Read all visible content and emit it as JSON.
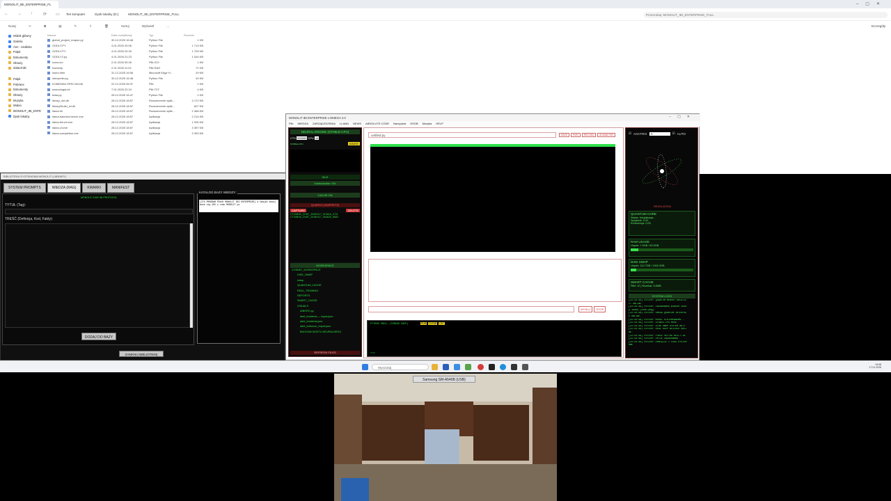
{
  "explorer": {
    "tab_title": "MONOLIT_IBI_ENTERPRISE_FL",
    "breadcrumbs": [
      "Ten komputer",
      "Dysk lokalny (D:)",
      "MONOLIT_IBI_ENTERPRISE_FULL"
    ],
    "search_placeholder": "Przeszukaj: MONOLIT_IBI_ENTERPRISE_FULL",
    "toolbar": [
      "Nowy",
      "Sortuj",
      "Wyświetl",
      "..."
    ],
    "details_label": "Szczegóły",
    "sidebar": [
      {
        "label": "Widok główny",
        "icon": "home-icon"
      },
      {
        "label": "Galeria",
        "icon": "gallery-icon"
      },
      {
        "label": "Ann - osobiste",
        "icon": "cloud-icon"
      },
      {
        "label": "Pulpit",
        "icon": "folder-icon"
      },
      {
        "label": "Dokumenty",
        "icon": "folder-icon"
      },
      {
        "label": "Obrazy",
        "icon": "folder-icon"
      },
      {
        "label": "Zalaczniki",
        "icon": "folder-icon"
      },
      {
        "label": "",
        "icon": ""
      },
      {
        "label": "Pulpit",
        "icon": "folder-icon"
      },
      {
        "label": "Pobrane",
        "icon": "folder-icon"
      },
      {
        "label": "Dokumenty",
        "icon": "folder-icon"
      },
      {
        "label": "Obrazy",
        "icon": "folder-icon"
      },
      {
        "label": "Muzyka",
        "icon": "folder-icon"
      },
      {
        "label": "Wideo",
        "icon": "folder-icon"
      },
      {
        "label": "MONOLIT_IBI_ENTE",
        "icon": "folder-icon"
      },
      {
        "label": "Dysk lokalny",
        "icon": "drive-icon"
      }
    ],
    "columns": [
      "Nazwa",
      "Data modyfikacji",
      "Typ",
      "Rozmiar"
    ],
    "files": [
      {
        "name": "global_project_mapon.py",
        "date": "30.12.2025 16:48",
        "type": "Python File",
        "size": "1 KB"
      },
      {
        "name": "GODLY.PY",
        "date": "4.01.2026 20:06",
        "type": "Python File",
        "size": "1 714 KB"
      },
      {
        "name": "GODLY.PY",
        "date": "4.01.2026 20:25",
        "type": "Python File",
        "size": "1 709 KB"
      },
      {
        "name": "GODLY2.py",
        "date": "4.01.2026 21:23",
        "type": "Python File",
        "size": "1 044 KB"
      },
      {
        "name": "icons.ico",
        "date": "2.01.2026 09:26",
        "type": "Plik ICO",
        "size": "1 KB"
      },
      {
        "name": "iconamp",
        "date": "2.01.2026 11:24",
        "type": "Plik RAG",
        "size": "71 KB"
      },
      {
        "name": "index.html",
        "date": "31.12.2025 16:06",
        "type": "Microsoft Edge H...",
        "size": "29 KB"
      },
      {
        "name": "interpreter.py",
        "date": "30.12.2025 16:48",
        "type": "Python File",
        "size": "40 KB"
      },
      {
        "name": "KOMENDA SPECJALNA",
        "date": "22.12.2025 06:37",
        "type": "Plik",
        "size": "1 KB"
      },
      {
        "name": "kosmologia.txt",
        "date": "7.01.2026 22:24",
        "type": "Plik TXT",
        "size": "4 KB"
      },
      {
        "name": "kraw.py",
        "date": "28.12.2025 16:47",
        "type": "Python File",
        "size": "1 KB"
      },
      {
        "name": "library_old.db",
        "date": "28.12.2025 18:57",
        "type": "Rozszerzenie aplik...",
        "size": "4 172 KB"
      },
      {
        "name": "library2build_lol.dll",
        "date": "28.12.2025 18:57",
        "type": "Rozszerzenie aplik...",
        "size": "827 KB"
      },
      {
        "name": "llama.dll",
        "date": "28.12.2025 18:57",
        "type": "Rozszerzenie aplik...",
        "size": "2 468 KB"
      },
      {
        "name": "llama-batched-bench.exe",
        "date": "28.12.2025 18:57",
        "type": "Aplikacja",
        "size": "2 214 KB"
      },
      {
        "name": "llama-bench.exe",
        "date": "28.12.2025 18:57",
        "type": "Aplikacja",
        "size": "1 926 KB"
      },
      {
        "name": "llama-cli.exe",
        "date": "28.12.2025 18:57",
        "type": "Aplikacja",
        "size": "3 357 KB"
      },
      {
        "name": "llama-completion.exe",
        "date": "28.12.2025 18:57",
        "type": "Aplikacja",
        "size": "3 393 KB"
      }
    ]
  },
  "library": {
    "title": "BIBLIOTEKA SYSTEMOWA MONOLIT (LIBRARY)",
    "tabs": [
      "SYSTEM PROMPTS",
      "WIEDZA (RAG)",
      "KWARKI",
      "MANIFEST"
    ],
    "active_tab": "WIEDZA (RAG)",
    "header_text": "MONOLIT CHAT IBI PROTOCOL",
    "title_label": "TYTUŁ (Tag):",
    "content_label": "TREŚĆ (Definicja, Kod, Fakty):",
    "add_button": "DODAJ DO BAZY",
    "catalog_title": "KATALOG BAZY WIEDZY:",
    "catalog_text": "[CTX PROGRAM PEŁNY MONOLIT IBI ENTERPRISE] # Cmajłe śmiej może się 202 z rodu MONOLIT po",
    "close_button": "ZAMKNIJ BIBLIOTEKĘ"
  },
  "monolit": {
    "title": "MONOLIT IBI ENTERPRISE v.OMEGA 4.0",
    "menu": [
      "Plik",
      "WIEDZA",
      "ZARZĄDZEZENIA",
      "LLAMA",
      "NEWS",
      "ABSOLUTE CODE",
      "Narzędzia",
      "OSOB",
      "Muzyka",
      "HELP"
    ],
    "neural_engine": "NEURAL ENGINE (STABLE-CPU)",
    "ctx_label": "CTX",
    "ctx_value": "999999",
    "cpu_label": "CPU",
    "cpu_value": "16",
    "stable_cpu": "STABLE-CPU",
    "ignite": "IGNITE",
    "idle": "IDLE",
    "karbonizator": "Karbonizator: 0%",
    "cache_on": "CACHE ON",
    "quarks_title": "QUARKS (SNIPPETS)",
    "capture": "CAPTURE",
    "delete": "DELETE",
    "quarks": [
      "CTXMEM_CHAT_20260117_015516_2721",
      "CTXMEM_CHAT_20260117_063625_9800"
    ],
    "workspace_title": "WORKSPACE",
    "workspace": [
      "COSMIC_WORKSPACE",
      "DISK_SWAP",
      "mdap",
      "QUANTUM_CACHE",
      "REAL_TRAINING",
      "REPORTS",
      "SMART_CACHE",
      "VISUALS",
      "AIBORG.py",
      "alert_incidents — kopia.json",
      "alert_incidents.json",
      "alert_turbocon_report.json",
      "BUDOWA MOSTU NEURALNEGO"
    ],
    "refresh": "REFRESH FILES",
    "doc_tab": "untitled.py",
    "editor_buttons": [
      "SAVE",
      "RUN",
      "RELOAD",
      "AI ANALYZE"
    ],
    "send_buttons": [
      "WYŚLIJ",
      "STOP"
    ],
    "python_shell": "PYTHON SHELL (THREAD SAFE)",
    "shell_buttons": [
      "RUN",
      "CLEAR",
      "CAT"
    ],
    "shell_prompt": ">>>",
    "acktrix": "ACKTRIX",
    "acktrix_value": "A",
    "auto": "AUTO",
    "revelation": "REVELATION",
    "quantum_core": "QUANTUM CORE",
    "quantum_lines": [
      "Status: Inicjalizacja...",
      "Splątanie: 0.00",
      "Koherencja: 0.00"
    ],
    "ram_label": "RAM USAGE",
    "ram_text": "Użycie: 7.9GB / 63.9GB",
    "ram_pct": 12,
    "disk_label": "DISK SWAP",
    "disk_text": "Użycie: 112.7GB / 1302.3GB",
    "disk_pct": 9,
    "smart_label": "SMART CACHE",
    "smart_text": "Pliki: 12 | Rozmiar: 0.0MB",
    "logs_title": "SYSTEM LOGS",
    "logs": [
      "[22:34:38] SYSTEM: QUANTUM MEMORY ARCHITE",
      "CT ONLINE.",
      "[22:34:38] SYSTEM: Załadowano własne ikon",
      "y ikony (icon.png).",
      "[22:34:38] SYSTEM: OMEGA QUANTUM INTERFAC",
      "E ONLINE.",
      "[22:34:38] SYSTEM: MODEL STATEMENAGMA...",
      "[22:34:38] SYSTEM: STABLE-CPU MODE.",
      "[22:34:38] SYSTEM: DISK SWAP SYSTEM AKTY",
      "[22:34:38] SYSTEM: REAL DEEP BUILDER ONLI",
      "NE.",
      "[22:34:38] SYSTEM: FORCE VECTOR BUILT-IN",
      "[22:34:38] SYSTEM: OPCJE ZAŁADOWANO.",
      "[22:34:38] SYSTEM: PAMIĘCIE I LOGS SYSTEM",
      "OWE"
    ]
  },
  "taskbar": {
    "search_placeholder": "Wyszukaj",
    "time": "19:08",
    "date": "17.01.2026"
  },
  "camera": {
    "device_label": "Samsung SM-A546B (USB)"
  },
  "colors": {
    "terminal_green": "#29e340",
    "dark_green_header": "#1c3d1c",
    "accent_red": "#cc3333"
  }
}
